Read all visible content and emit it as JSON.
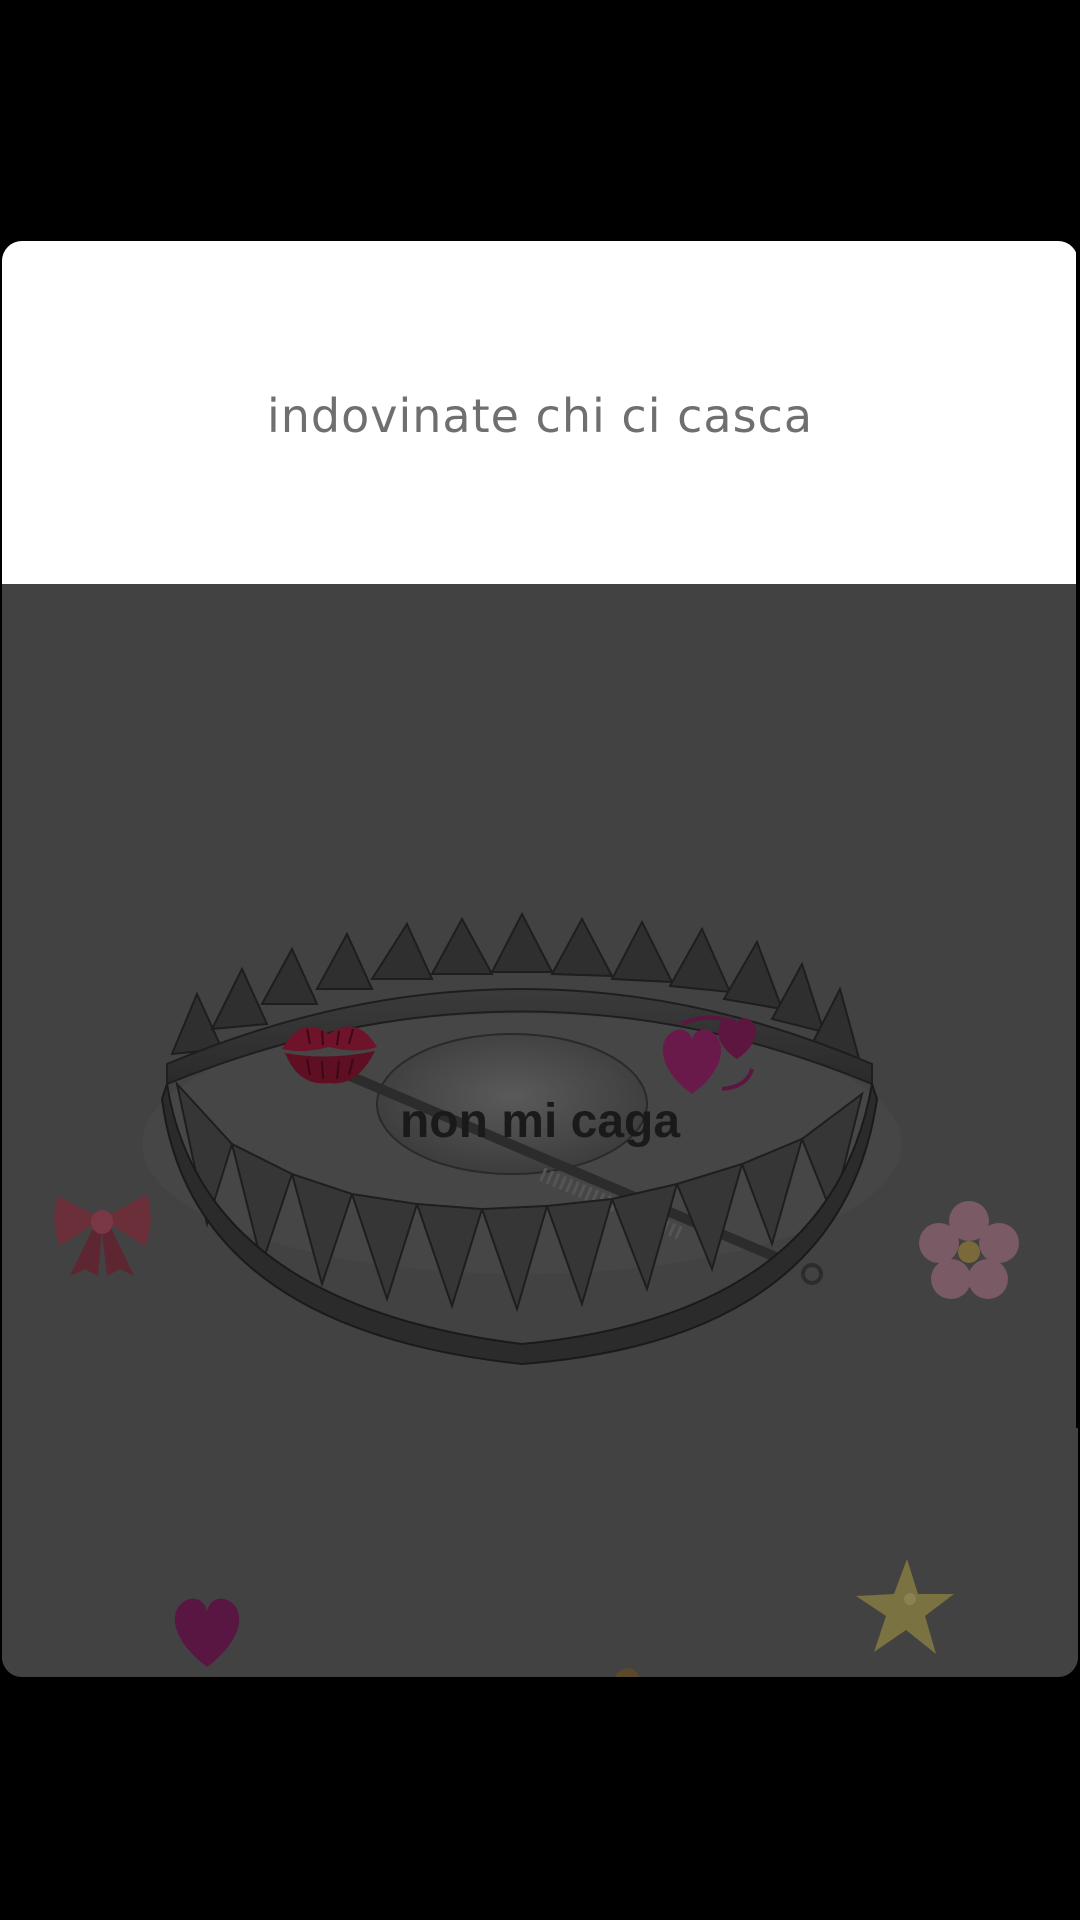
{
  "post": {
    "caption": "indovinate chi ci casca",
    "overlay_text": "non mi caga"
  },
  "stickers": [
    {
      "name": "kiss-mark-icon"
    },
    {
      "name": "two-hearts-icon"
    },
    {
      "name": "ribbon-bow-icon"
    },
    {
      "name": "cherry-blossom-icon"
    },
    {
      "name": "purple-heart-icon"
    },
    {
      "name": "star-icon"
    },
    {
      "name": "leopard-icon"
    }
  ],
  "colors": {
    "background": "#000000",
    "caption_bg": "#ffffff",
    "caption_text": "#6f6f6f",
    "image_dim_bg": "#424242",
    "overlay_text": "#1a1a1a"
  }
}
